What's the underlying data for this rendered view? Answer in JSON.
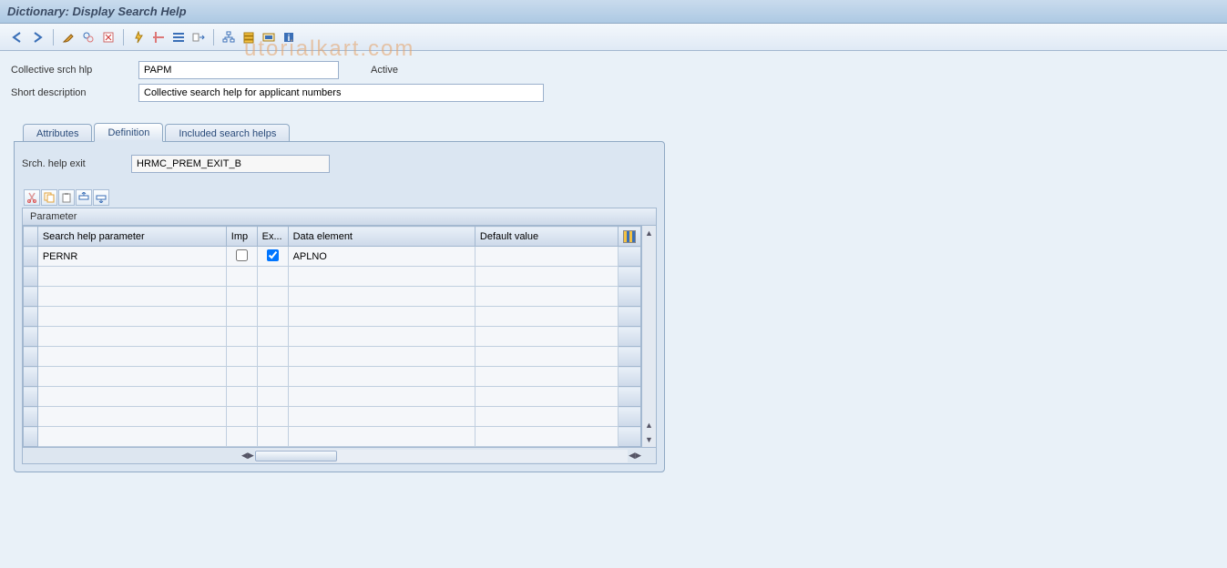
{
  "title": "Dictionary: Display Search Help",
  "watermark": "utorialkart.com",
  "form": {
    "coll_label": "Collective srch hlp",
    "coll_value": "PAPM",
    "status": "Active",
    "desc_label": "Short description",
    "desc_value": "Collective search help for applicant numbers"
  },
  "tabs": [
    {
      "label": "Attributes",
      "active": false
    },
    {
      "label": "Definition",
      "active": true
    },
    {
      "label": "Included search helps",
      "active": false
    }
  ],
  "exit": {
    "label": "Srch. help exit",
    "value": "HRMC_PREM_EXIT_B"
  },
  "section_title": "Parameter",
  "columns": {
    "c1": "Search help parameter",
    "c2": "Imp",
    "c3": "Ex...",
    "c4": "Data element",
    "c5": "Default value"
  },
  "rows": [
    {
      "param": "PERNR",
      "imp": false,
      "exp": true,
      "elem": "APLNO",
      "def": ""
    }
  ],
  "icons": {
    "back": "⇦",
    "fwd": "⇨",
    "wand": "✎",
    "glasses": "👓",
    "activate": "❐",
    "match": "🝰",
    "where": "⎌",
    "tree": "品",
    "hier": "昌",
    "layout": "▦",
    "help": "ℹ"
  }
}
